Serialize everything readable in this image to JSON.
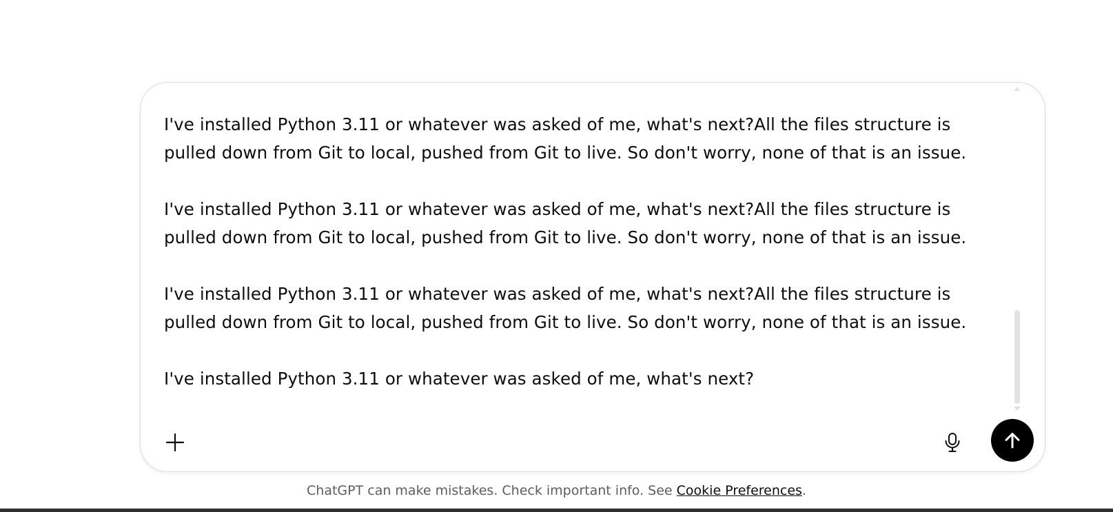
{
  "composer": {
    "paragraphs": [
      "I've installed Python 3.11 or whatever was asked of me, what's next?All the files structure is pulled down from Git to local, pushed from Git to live. So don't worry, none of that is an issue.",
      "I've installed Python 3.11 or whatever was asked of me, what's next?All the files structure is pulled down from Git to local, pushed from Git to live. So don't worry, none of that is an issue.",
      "I've installed Python 3.11 or whatever was asked of me, what's next?All the files structure is pulled down from Git to local, pushed from Git to live. So don't worry, none of that is an issue.",
      "I've installed Python 3.11 or whatever was asked of me, what's next?"
    ],
    "icons": {
      "attach": "plus-icon",
      "voice": "microphone-icon",
      "send": "arrow-up-icon"
    },
    "colors": {
      "send_background": "#000000",
      "border": "#dcdcdc"
    }
  },
  "footer": {
    "disclaimer_prefix": "ChatGPT can make mistakes. Check important info. See ",
    "link_text": "Cookie Preferences",
    "disclaimer_suffix": "."
  }
}
